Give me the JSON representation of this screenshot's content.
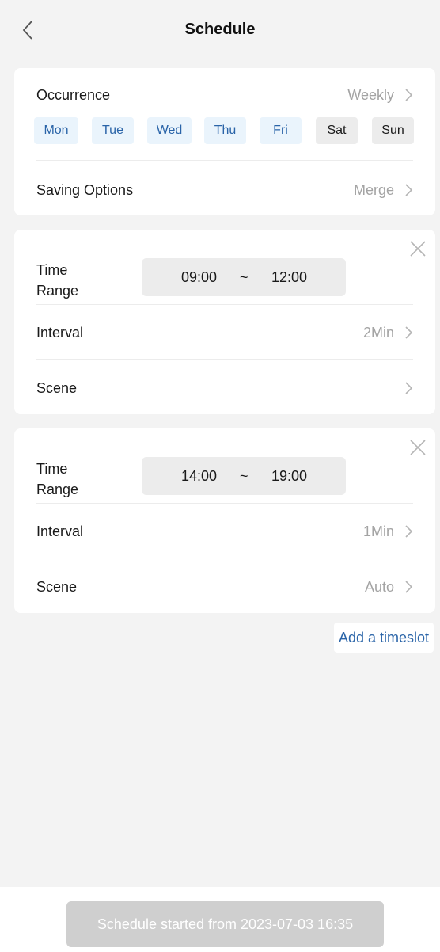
{
  "header": {
    "title": "Schedule",
    "back_icon": "chevron-left-icon"
  },
  "occurrence": {
    "label": "Occurrence",
    "value": "Weekly",
    "days": [
      {
        "label": "Mon",
        "selected": true
      },
      {
        "label": "Tue",
        "selected": true
      },
      {
        "label": "Wed",
        "selected": true
      },
      {
        "label": "Thu",
        "selected": true
      },
      {
        "label": "Fri",
        "selected": true
      },
      {
        "label": "Sat",
        "selected": false
      },
      {
        "label": "Sun",
        "selected": false
      }
    ],
    "saving_label": "Saving Options",
    "saving_value": "Merge"
  },
  "timeslots": [
    {
      "time_range_label": "Time\nRange",
      "start": "09:00",
      "separator": "~",
      "end": "12:00",
      "interval_label": "Interval",
      "interval_value": "2Min",
      "scene_label": "Scene",
      "scene_value": ""
    },
    {
      "time_range_label": "Time\nRange",
      "start": "14:00",
      "separator": "~",
      "end": "19:00",
      "interval_label": "Interval",
      "interval_value": "1Min",
      "scene_label": "Scene",
      "scene_value": "Auto"
    }
  ],
  "add_timeslot_label": "Add a timeslot",
  "footer": {
    "start_label": "Schedule started from 2023-07-03 16:35"
  },
  "colors": {
    "accent": "#2a64a8",
    "selected_day_bg": "#eaf4fc",
    "unselected_day_bg": "#ececec",
    "muted_text": "#a3a3a3",
    "disabled_button": "#cfcfcf"
  }
}
